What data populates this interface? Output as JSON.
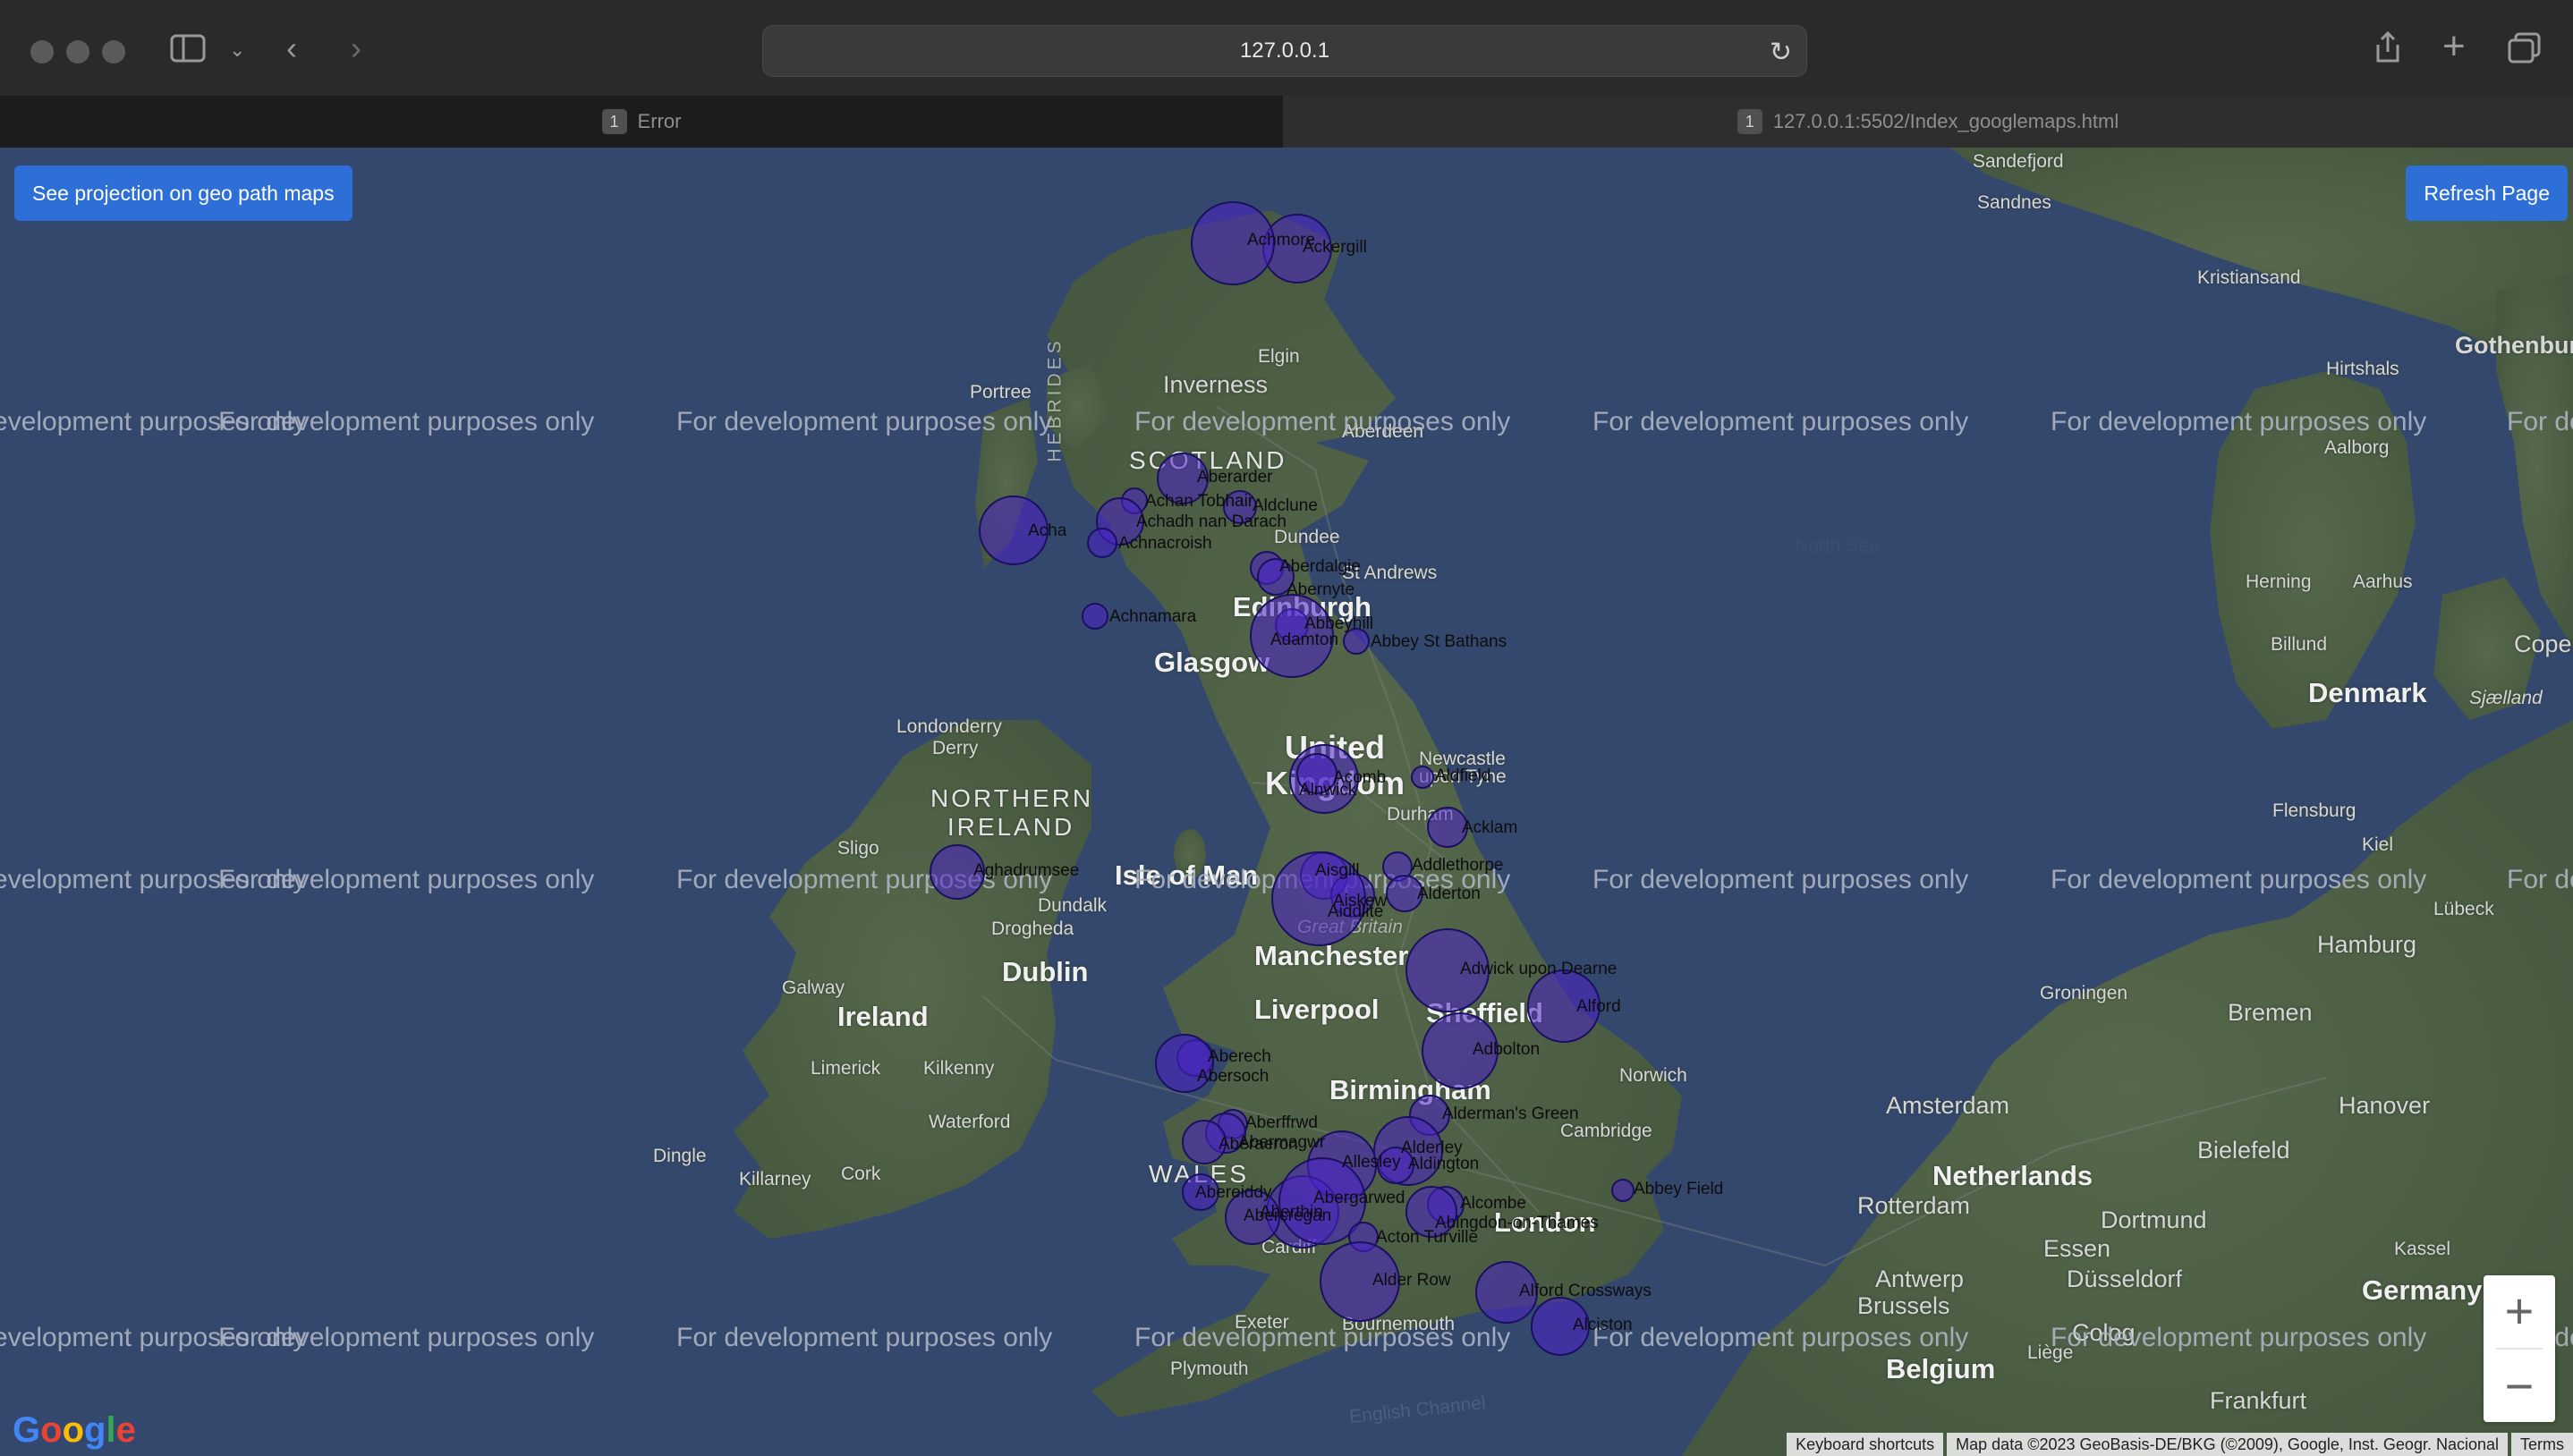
{
  "browser": {
    "url": "127.0.0.1",
    "tabs": [
      {
        "badge": "1",
        "label": "Error"
      },
      {
        "badge": "1",
        "label": "127.0.0.1:5502/Index_googlemaps.html"
      }
    ]
  },
  "map": {
    "buttons": {
      "geo_path": "See projection on geo path maps",
      "refresh": "Refresh Page"
    },
    "watermark": "For development purposes only",
    "zoom_in": "+",
    "zoom_out": "−",
    "attribution": {
      "shortcuts": "Keyboard shortcuts",
      "map_data": "Map data ©2023 GeoBasis-DE/BKG (©2009), Google, Inst. Geogr. Nacional",
      "terms": "Terms"
    },
    "logo": "Google",
    "colors": {
      "water": "#34486e",
      "land": "#4f6148",
      "marker_fill": "#4b22c8",
      "button": "#2d6fd6"
    },
    "places": {
      "sandefjord": "Sandefjord",
      "sandnes": "Sandnes",
      "kristiansand": "Kristiansand",
      "hirtshals": "Hirtshals",
      "gothenburg": "Gothenbur",
      "aalborg": "Aalborg",
      "north_sea": "North Sea",
      "herning": "Herning",
      "aarhus": "Aarhus",
      "billund": "Billund",
      "denmark": "Denmark",
      "sjaelland": "Sjælland",
      "copenhagen": "Copen",
      "flensburg": "Flensburg",
      "kiel": "Kiel",
      "lubeck": "Lübeck",
      "hamburg": "Hamburg",
      "groningen": "Groningen",
      "bremen": "Bremen",
      "amsterdam": "Amsterdam",
      "hanover": "Hanover",
      "netherlands": "Netherlands",
      "bielefeld": "Bielefeld",
      "rotterdam": "Rotterdam",
      "dortmund": "Dortmund",
      "essen": "Essen",
      "kassel": "Kassel",
      "antwerp": "Antwerp",
      "dusseldorf": "Düsseldorf",
      "brussels": "Brussels",
      "cologne": "Colog",
      "germany": "Germany",
      "belgium": "Belgium",
      "liege": "Liège",
      "frankfurt": "Frankfurt",
      "inverness": "Inverness",
      "elgin": "Elgin",
      "portree": "Portree",
      "scotland": "SCOTLAND",
      "dundee": "Dundee",
      "edinburgh": "Edinburgh",
      "glasgow": "Glasgow",
      "st_andrews": "St Andrews",
      "aberdeen": "Aberdeen",
      "londonderry": "Londonderry",
      "derry": "Derry",
      "northern_ireland": "NORTHERN IRELAND",
      "sligo": "Sligo",
      "isle_of_man": "Isle of Man",
      "dundalk": "Dundalk",
      "drogheda": "Drogheda",
      "dublin": "Dublin",
      "galway": "Galway",
      "ireland": "Ireland",
      "limerick": "Limerick",
      "kilkenny": "Kilkenny",
      "waterford": "Waterford",
      "dingle": "Dingle",
      "killarney": "Killarney",
      "cork": "Cork",
      "newcastle": "Newcastle",
      "upon_tyne": "upon Tyne",
      "durham": "Durham",
      "united": "United",
      "kingdom": "Kingdom",
      "great_britain": "Great Britain",
      "manchester": "Manchester",
      "liverpool": "Liverpool",
      "sheffield": "Sheffield",
      "birmingham": "Birmingham",
      "norwich": "Norwich",
      "cambridge": "Cambridge",
      "wales": "WALES",
      "london": "London",
      "cardiff": "Cardiff",
      "exeter": "Exeter",
      "bournemouth": "Bournemouth",
      "plymouth": "Plymouth",
      "english_channel": "English Channel",
      "hebrides": "HEBRIDES"
    },
    "markers": [
      {
        "label": "Ackergill"
      },
      {
        "label": "Achmore"
      },
      {
        "label": "Aberarder"
      },
      {
        "label": "Achan Tobhair"
      },
      {
        "label": "Achadh nan Darach"
      },
      {
        "label": "Achnacroish"
      },
      {
        "label": "Aldclune"
      },
      {
        "label": "Acha"
      },
      {
        "label": "Aberdalgie"
      },
      {
        "label": "Abernyte"
      },
      {
        "label": "Achnamara"
      },
      {
        "label": "Abbeyhill"
      },
      {
        "label": "Adamton"
      },
      {
        "label": "Abbey St Bathans"
      },
      {
        "label": "Acomb"
      },
      {
        "label": "Alnwick"
      },
      {
        "label": "Aldfield"
      },
      {
        "label": "Acklam"
      },
      {
        "label": "Aghadrumsee"
      },
      {
        "label": "Aisgill"
      },
      {
        "label": "Addlethorpe"
      },
      {
        "label": "Aiskew"
      },
      {
        "label": "Alderton"
      },
      {
        "label": "Aiddlite"
      },
      {
        "label": "Adwick upon Dearne"
      },
      {
        "label": "Alford"
      },
      {
        "label": "Adbolton"
      },
      {
        "label": "Aberech"
      },
      {
        "label": "Abersoch"
      },
      {
        "label": "Alderman's Green"
      },
      {
        "label": "Aberffrwd"
      },
      {
        "label": "Abermagwr"
      },
      {
        "label": "Aberaeron"
      },
      {
        "label": "Allesley"
      },
      {
        "label": "Alderley"
      },
      {
        "label": "Aldington"
      },
      {
        "label": "Abbey Field"
      },
      {
        "label": "Abereiddy"
      },
      {
        "label": "Aberthin"
      },
      {
        "label": "Abergarwed"
      },
      {
        "label": "Abercregan"
      },
      {
        "label": "Alcombe"
      },
      {
        "label": "Abingdon-on-Thames"
      },
      {
        "label": "Acton Turville"
      },
      {
        "label": "Alder Row"
      },
      {
        "label": "Alford Crossways"
      },
      {
        "label": "Alciston"
      }
    ]
  }
}
